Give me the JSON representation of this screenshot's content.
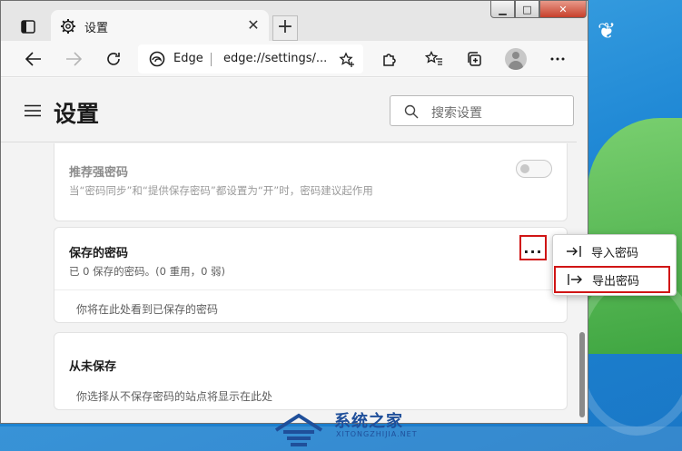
{
  "browser": {
    "tab": {
      "title": "设置"
    },
    "address": {
      "site": "Edge",
      "url": "edge://settings/..."
    }
  },
  "settings": {
    "title": "设置",
    "search_placeholder": "搜索设置",
    "suggest_strong": {
      "title": "推荐强密码",
      "description": "当“密码同步”和“提供保存密码”都设置为“开”时，密码建议起作用",
      "toggle_on": false
    },
    "saved_passwords": {
      "title": "保存的密码",
      "summary": "已 0 保存的密码。(0 重用，0 弱)",
      "more_glyph": "...",
      "empty_text": "你将在此处看到已保存的密码"
    },
    "never_saved": {
      "title": "从未保存",
      "empty_text": "你选择从不保存密码的站点将显示在此处"
    }
  },
  "context_menu": {
    "items": [
      {
        "label": "导入密码",
        "icon": "import-icon"
      },
      {
        "label": "导出密码",
        "icon": "export-icon",
        "highlighted": true
      }
    ]
  },
  "watermark": {
    "brand_cn": "系统之家",
    "brand_en": "XITONGZHIJIA.NET"
  },
  "colors": {
    "highlight_red": "#d01515",
    "desktop_blue": "#2a8fd6",
    "watermark_blue": "#1f4f9a"
  }
}
